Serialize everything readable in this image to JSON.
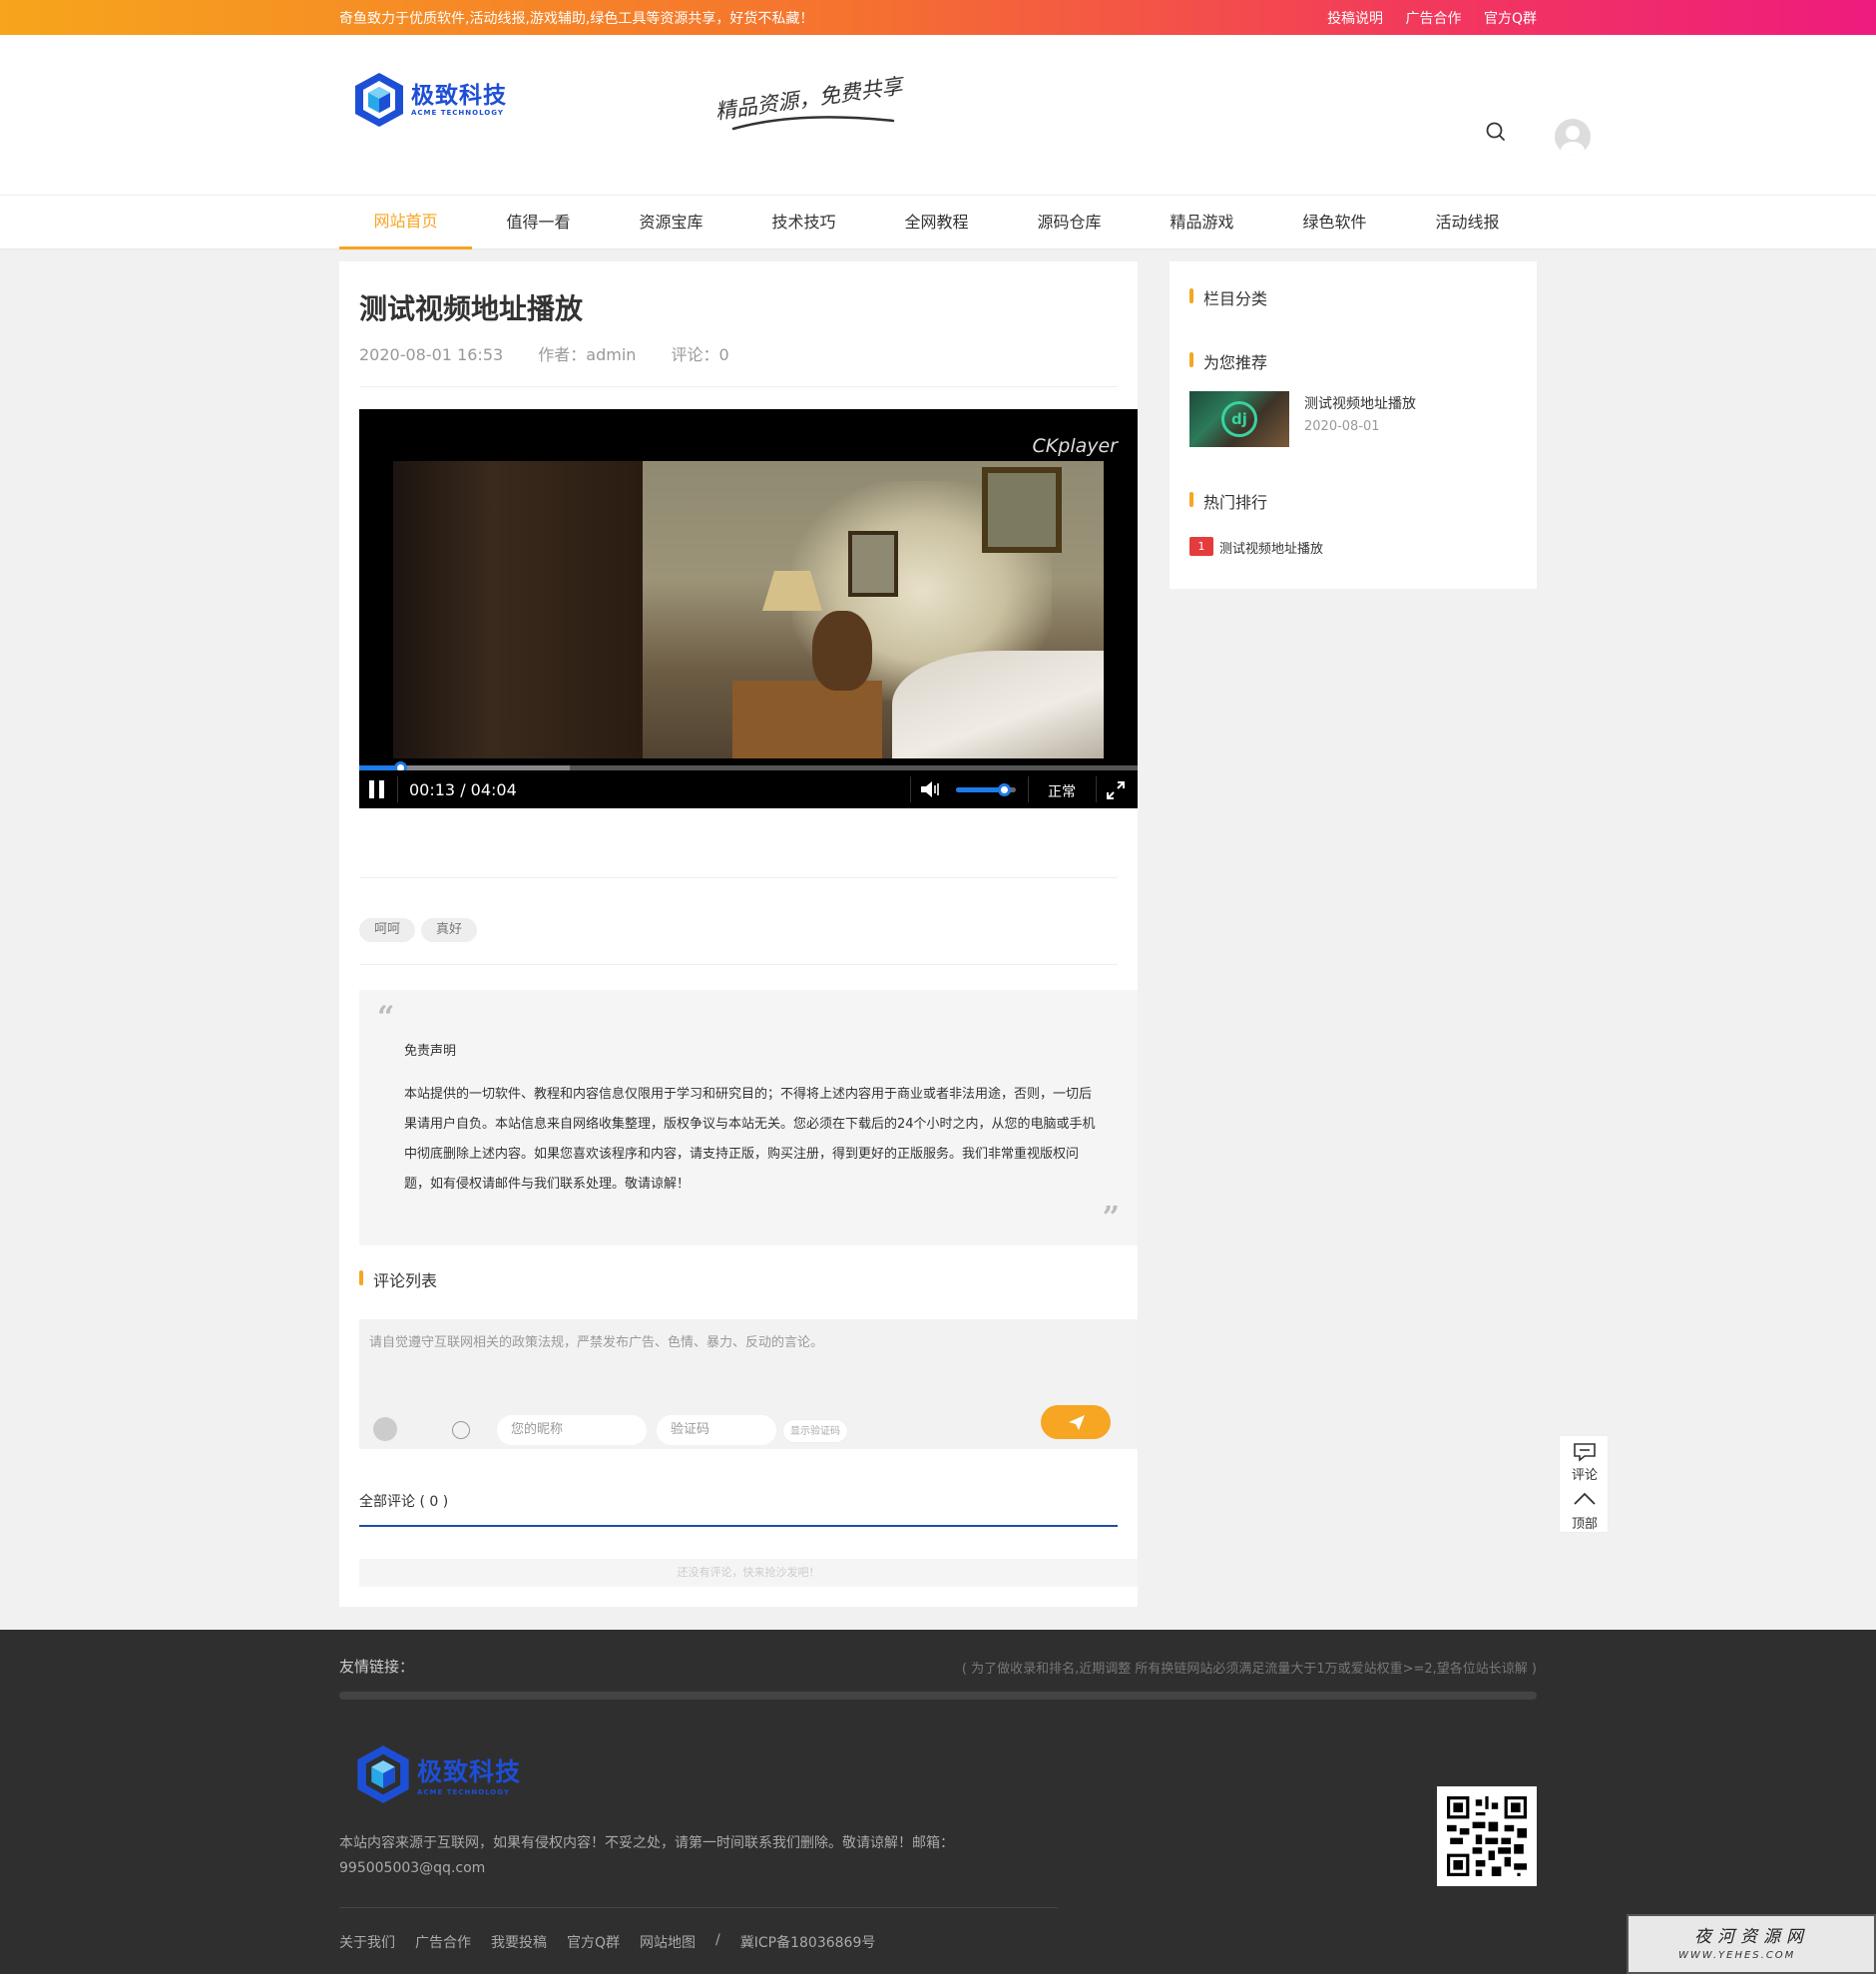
{
  "topbar": {
    "notice": "奇鱼致力于优质软件,活动线报,游戏辅助,绿色工具等资源共享，好货不私藏！",
    "links": [
      "投稿说明",
      "广告合作",
      "官方Q群"
    ]
  },
  "header": {
    "logo_cn": "极致科技",
    "logo_en": "ACME TECHNOLOGY",
    "slogan": "精品资源，免费共享"
  },
  "nav": {
    "items": [
      "网站首页",
      "值得一看",
      "资源宝库",
      "技术技巧",
      "全网教程",
      "源码仓库",
      "精品游戏",
      "绿色软件",
      "活动线报"
    ],
    "active_index": 0
  },
  "article": {
    "title": "测试视频地址播放",
    "date": "2020-08-01 16:53",
    "author": "作者：admin",
    "comments": "评论：0"
  },
  "player": {
    "brand": "CKplayer",
    "time": "00:13 / 04:04",
    "speed": "正常",
    "progress": 0.053,
    "buffered": 0.27,
    "volume": 0.8
  },
  "tags": [
    "呵呵",
    "真好"
  ],
  "disclaimer": {
    "title": "免责声明",
    "body": "本站提供的一切软件、教程和内容信息仅限用于学习和研究目的；不得将上述内容用于商业或者非法用途，否则，一切后果请用户自负。本站信息来自网络收集整理，版权争议与本站无关。您必须在下载后的24个小时之内，从您的电脑或手机中彻底删除上述内容。如果您喜欢该程序和内容，请支持正版，购买注册，得到更好的正版服务。我们非常重视版权问题，如有侵权请邮件与我们联系处理。敬请谅解！"
  },
  "comments": {
    "section_title": "评论列表",
    "placeholder": "请自觉遵守互联网相关的政策法规，严禁发布广告、色情、暴力、反动的言论。",
    "nickname_placeholder": "您的昵称",
    "captcha_placeholder": "验证码",
    "show_captcha": "显示验证码",
    "all_label": "全部评论 ( 0 )",
    "empty": "还没有评论，快来抢沙发吧！"
  },
  "sidebar": {
    "category_title": "栏目分类",
    "recommend_title": "为您推荐",
    "recommend_item_title": "测试视频地址播放",
    "recommend_item_date": "2020-08-01",
    "hot_title": "热门排行",
    "hot_rank": "1",
    "hot_item_title": "测试视频地址播放"
  },
  "floatbar": {
    "comment": "评论",
    "top": "顶部"
  },
  "footer": {
    "friend_links_title": "友情链接：",
    "friend_links_note": "( 为了做收录和排名,近期调整 所有换链网站必须满足流量大于1万或爱站权重>=2,望各位站长谅解 )",
    "logo_cn": "极致科技",
    "logo_en": "ACME TECHNOLOGY",
    "desc": "本站内容来源于互联网，如果有侵权内容！不妥之处，请第一时间联系我们删除。敬请谅解！邮箱：995005003@qq.com",
    "links": [
      "关于我们",
      "广告合作",
      "我要投稿",
      "官方Q群",
      "网站地图",
      "/",
      "冀ICP备18036869号"
    ]
  },
  "watermark": {
    "cn": "夜河资源网",
    "en": "WWW.YEHES.COM"
  },
  "colors": {
    "accent": "#f6a623",
    "brand_blue": "#1d4fd6",
    "topbar_start": "#f7a51c",
    "topbar_end": "#ee1b7e",
    "rank_red": "#e43c3c",
    "player_blue": "#1e7be8"
  }
}
